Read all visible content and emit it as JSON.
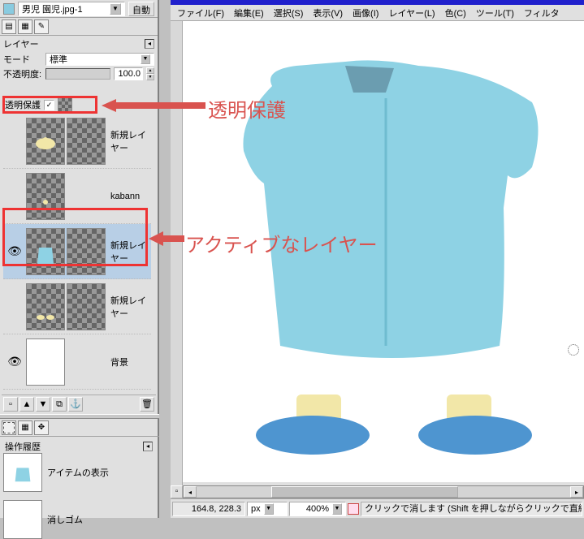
{
  "title_dropdown": "男児 園児.jpg-1",
  "auto_button": "自動",
  "layers_panel_title": "レイヤー",
  "mode_label": "モード",
  "mode_value": "標準",
  "opacity_label": "不透明度:",
  "opacity_value": "100.0",
  "transparency_label": "透明保護",
  "layers": [
    {
      "eye": false,
      "name": "新規レイヤー",
      "active": false,
      "transparent": true,
      "content": "hat"
    },
    {
      "eye": false,
      "name": "kabann",
      "active": false,
      "transparent": true,
      "content": "dot"
    },
    {
      "eye": true,
      "name": "新規レイヤー",
      "active": true,
      "transparent": true,
      "content": "shirt"
    },
    {
      "eye": false,
      "name": "新規レイヤー",
      "active": false,
      "transparent": true,
      "content": "shoes"
    },
    {
      "eye": true,
      "name": "背景",
      "active": false,
      "transparent": false,
      "content": "blank"
    }
  ],
  "history_panel_title": "操作履歴",
  "history_item1": "アイテムの表示",
  "history_item2": "消しゴム",
  "menus": {
    "file": "ファイル(F)",
    "edit": "編集(E)",
    "select": "選択(S)",
    "view": "表示(V)",
    "image": "画像(I)",
    "layer": "レイヤー(L)",
    "colors": "色(C)",
    "tools": "ツール(T)",
    "filters": "フィルタ"
  },
  "annotation1": "透明保護",
  "annotation2": "アクティブなレイヤー",
  "status": {
    "coords": "164.8, 228.3",
    "unit": "px",
    "zoom": "400%",
    "hint": "クリックで消します (Shift を押しながらクリックで直線を引く、Ctrl を押しな"
  },
  "colors": {
    "accent_red": "#d9534f",
    "shirt_blue": "#8ed2e4",
    "collar": "#5f93a7",
    "shoe_blue": "#4e95d0",
    "shoe_yellow": "#f2e7a8"
  }
}
